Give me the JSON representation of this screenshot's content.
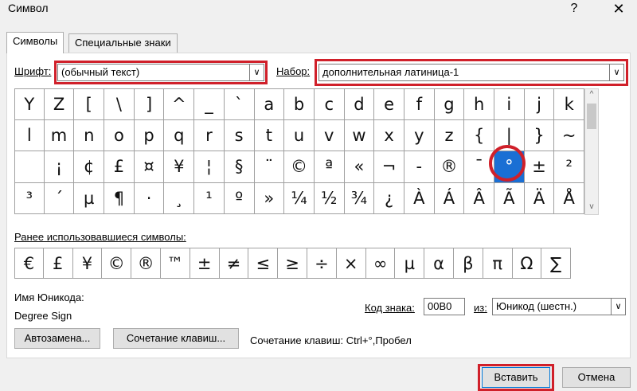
{
  "window": {
    "title": "Символ",
    "help_label": "?",
    "close_label": "✕"
  },
  "tabs": [
    {
      "label": "Символы",
      "active": true
    },
    {
      "label": "Специальные знаки",
      "active": false
    }
  ],
  "font": {
    "label": "Шрифт:",
    "value": "(обычный текст)"
  },
  "subset": {
    "label": "Набор:",
    "value": "дополнительная латиница-1"
  },
  "symbol_grid": {
    "rows": [
      [
        "Y",
        "Z",
        "[",
        "\\",
        "]",
        "^",
        "_",
        "`",
        "a",
        "b",
        "c",
        "d",
        "e",
        "f",
        "g",
        "h",
        "i",
        "j",
        "k"
      ],
      [
        "l",
        "m",
        "n",
        "o",
        "p",
        "q",
        "r",
        "s",
        "t",
        "u",
        "v",
        "w",
        "x",
        "y",
        "z",
        "{",
        "|",
        "}",
        "~"
      ],
      [
        " ",
        "¡",
        "¢",
        "£",
        "¤",
        "¥",
        "¦",
        "§",
        "¨",
        "©",
        "ª",
        "«",
        "¬",
        "-",
        "®",
        "¯",
        "°",
        "±",
        "²"
      ],
      [
        "³",
        "´",
        "µ",
        "¶",
        "·",
        "¸",
        "¹",
        "º",
        "»",
        "¼",
        "½",
        "¾",
        "¿",
        "À",
        "Á",
        "Â",
        "Ã",
        "Ä",
        "Å"
      ]
    ],
    "selected": {
      "row": 2,
      "col": 16
    },
    "scroll_up": "^",
    "scroll_down": "v"
  },
  "recent": {
    "label": "Ранее использовавшиеся символы:",
    "symbols": [
      "€",
      "£",
      "¥",
      "©",
      "®",
      "™",
      "±",
      "≠",
      "≤",
      "≥",
      "÷",
      "×",
      "∞",
      "µ",
      "α",
      "β",
      "π",
      "Ω",
      "∑"
    ]
  },
  "unicode_name": {
    "label": "Имя Юникода:",
    "value": "Degree Sign"
  },
  "char_code": {
    "label": "Код знака:",
    "value": "00B0"
  },
  "from": {
    "label": "из:",
    "value": "Юникод (шестн.)"
  },
  "buttons": {
    "autocorrect": "Автозамена...",
    "shortcut_key": "Сочетание клавиш...",
    "shortcut_text": "Сочетание клавиш: Ctrl+°,Пробел",
    "insert": "Вставить",
    "cancel": "Отмена"
  },
  "colors": {
    "highlight": "#d0202a",
    "selection": "#1a6fd4"
  },
  "icons": {
    "dropdown": "chevron-down-icon"
  }
}
